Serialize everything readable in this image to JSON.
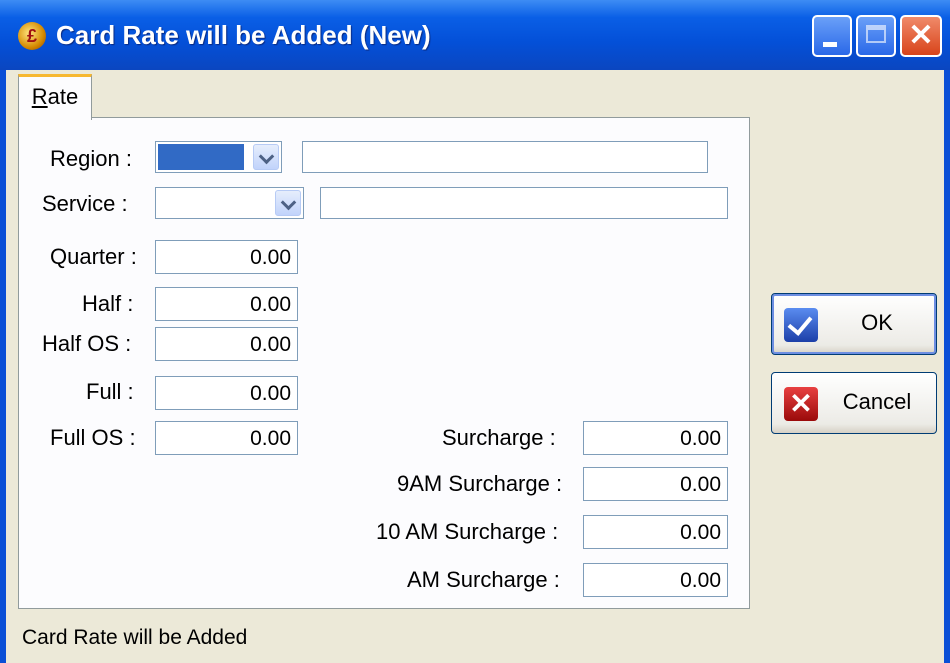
{
  "window": {
    "title": "Card Rate will be Added  (New)",
    "icon": "pound-coin-icon",
    "close_glyph": "✕"
  },
  "tab": {
    "label_hotkey": "R",
    "label_rest": "ate"
  },
  "form": {
    "region_label": "Region :",
    "service_label": "Service :",
    "quarter_label": "Quarter :",
    "quarter_value": "0.00",
    "half_label": "Half :",
    "half_value": "0.00",
    "half_os_label": "Half OS :",
    "half_os_value": "0.00",
    "full_label": "Full :",
    "full_value": "0.00",
    "full_os_label": "Full OS :",
    "full_os_value": "0.00",
    "surcharge_label": "Surcharge :",
    "surcharge_value": "0.00",
    "surcharge_9am_label": "9AM Surcharge :",
    "surcharge_9am_value": "0.00",
    "surcharge_10am_label": "10 AM Surcharge :",
    "surcharge_10am_value": "0.00",
    "surcharge_am_label": "AM Surcharge :",
    "surcharge_am_value": "0.00"
  },
  "buttons": {
    "ok_label": "OK",
    "cancel_label": "Cancel",
    "cancel_glyph": "✕"
  },
  "status": {
    "text": "Card Rate will be Added"
  }
}
